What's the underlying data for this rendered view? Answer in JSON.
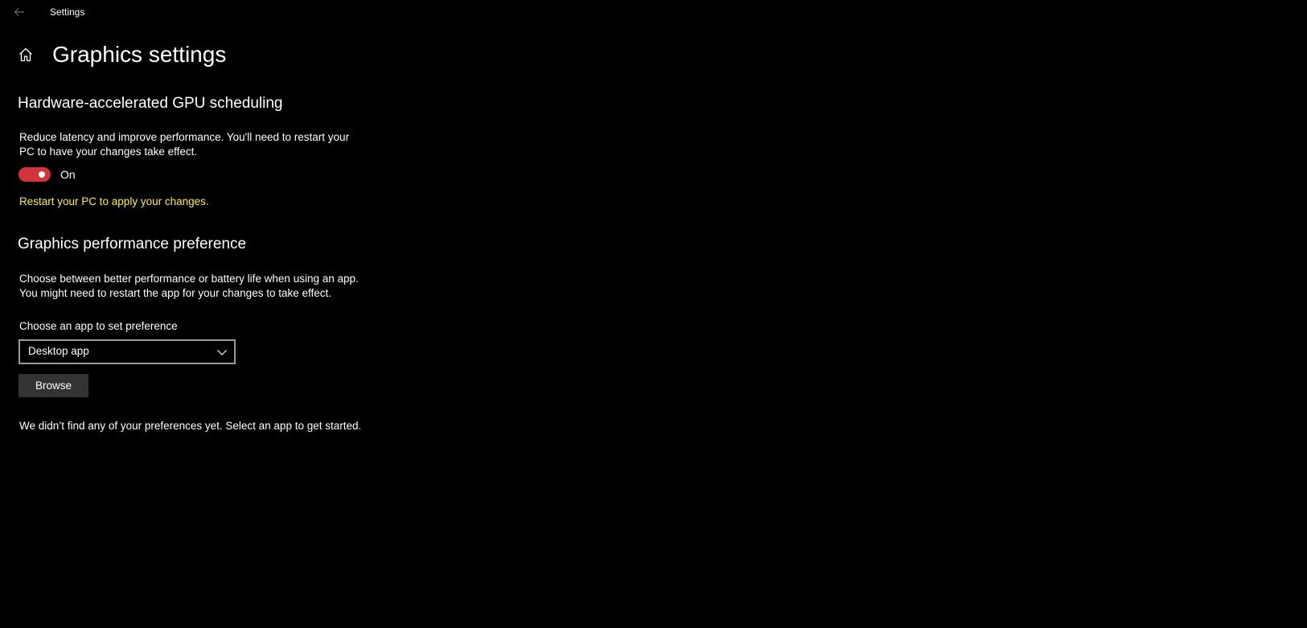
{
  "window": {
    "title": "Settings"
  },
  "page": {
    "title": "Graphics settings"
  },
  "gpu_scheduling": {
    "heading": "Hardware-accelerated GPU scheduling",
    "description_line1": "Reduce latency and improve performance. You'll need to restart your",
    "description_line2": "PC to have your changes take effect.",
    "toggle_state": "On",
    "toggle_on": true,
    "toggle_color": "#d1343b",
    "restart_notice": "Restart your PC to apply your changes.",
    "restart_notice_color": "#ffef3c"
  },
  "performance_preference": {
    "heading": "Graphics performance preference",
    "description_line1": "Choose between better performance or battery life when using an app.",
    "description_line2": "You might need to restart the app for your changes to take effect.",
    "select_label": "Choose an app to set preference",
    "selected_app_type": "Desktop app",
    "browse_label": "Browse",
    "empty_message": "We didn’t find any of your preferences yet. Select an app to get started."
  },
  "icons": {
    "back": "back-arrow-icon",
    "home": "home-icon",
    "dropdown": "chevron-down-icon"
  }
}
